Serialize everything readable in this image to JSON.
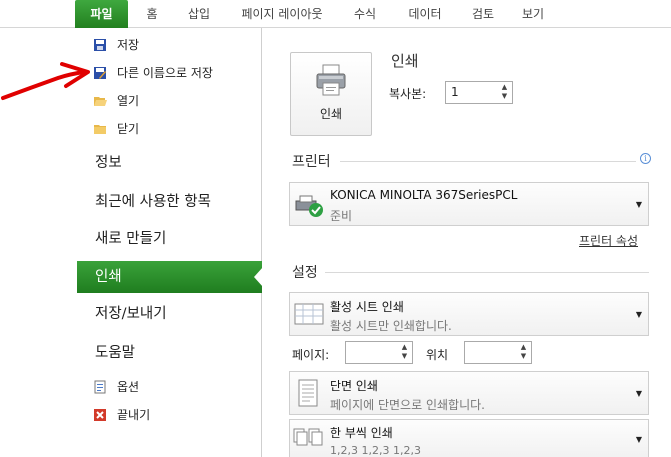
{
  "tabs": [
    "파일",
    "홈",
    "삽입",
    "페이지 레이아웃",
    "수식",
    "데이터",
    "검토",
    "보기"
  ],
  "backstage": {
    "small_top": [
      {
        "label": "저장",
        "icon": "save-icon"
      },
      {
        "label": "다른 이름으로 저장",
        "icon": "save-as-icon"
      },
      {
        "label": "열기",
        "icon": "open-folder-icon"
      },
      {
        "label": "닫기",
        "icon": "close-folder-icon"
      }
    ],
    "big": [
      "정보",
      "최근에 사용한 항목",
      "새로 만들기",
      "인쇄",
      "저장/보내기",
      "도움말"
    ],
    "selected": "인쇄",
    "small_bottom": [
      {
        "label": "옵션",
        "icon": "options-icon"
      },
      {
        "label": "끝내기",
        "icon": "exit-icon"
      }
    ]
  },
  "print": {
    "button_label": "인쇄",
    "title": "인쇄",
    "copies_label": "복사본:",
    "copies_value": "1"
  },
  "printer": {
    "section": "프린터",
    "name": "KONICA MINOLTA 367SeriesPCL",
    "status": "준비",
    "properties_link": "프린터 속성"
  },
  "settings": {
    "section": "설정",
    "scope_title": "활성 시트 인쇄",
    "scope_sub": "활성 시트만 인쇄합니다.",
    "pages_label": "페이지:",
    "pages_from": "",
    "to_label": "위치",
    "pages_to": "",
    "sides_title": "단면 인쇄",
    "sides_sub": "페이지에 단면으로 인쇄합니다.",
    "collate_title": "한 부씩 인쇄",
    "collate_sub": "1,2,3    1,2,3    1,2,3"
  },
  "colors": {
    "accent_green": "#23801f",
    "annotation_red": "#e00000"
  }
}
